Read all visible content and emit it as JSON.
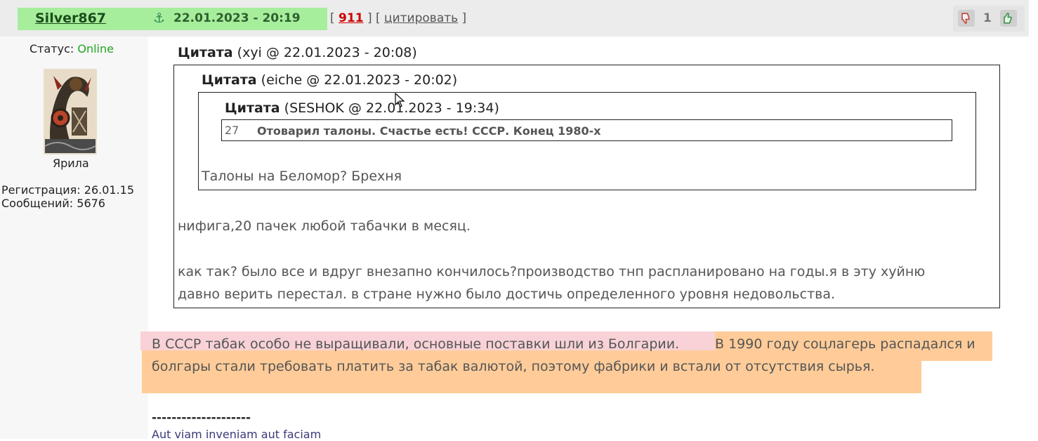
{
  "header": {
    "username": "Silver867",
    "datetime": "22.01.2023 - 20:19",
    "post_number": "911",
    "quote_label": "цитировать",
    "vote_count": "1",
    "icons": {
      "anchor": "anchor-icon",
      "dislike": "thumb-down-icon",
      "like": "thumb-up-icon"
    },
    "colors": {
      "user_bg": "#a6ee9c",
      "post_number": "#cc0000",
      "online": "#22a522"
    }
  },
  "sidebar": {
    "status_label": "Статус:",
    "status_value": "Online",
    "avatar_name": "Ярила",
    "registration": "Регистрация: 26.01.15",
    "messages": "Сообщений: 5676"
  },
  "quotes": {
    "outer": {
      "label": "Цитата",
      "meta": "(xyi @ 22.01.2023 - 20:08)"
    },
    "middle": {
      "label": "Цитата",
      "meta": "(eiche @ 22.01.2023 - 20:02)"
    },
    "inner": {
      "label": "Цитата",
      "meta": "(SESHOK @ 22.01.2023 - 19:34)"
    },
    "inner_link_num": "27",
    "inner_link_title": "Отоварил талоны. Счастье есть! СССР. Конец 1980-х",
    "middle_text": "Талоны на Беломор? Брехня",
    "outer_text_1": "нифига,20 пачек любой табачки в месяц.",
    "outer_text_2": "как так? было все и вдруг внезапно кончилось?производство тнп распланировано на годы.я в эту хуйню",
    "outer_text_3": "давно верить перестал. в стране нужно было достичь определенного уровня недовольства."
  },
  "post": {
    "line1_part1": "В СССР табак особо не выращивали, основные поставки шли из Болгарии.",
    "line1_part2": "В 1990 году соцлагерь распадался и",
    "line2": "болгары стали требовать платить за табак валютой, поэтому фабрики и встали от отсутствия сырья."
  },
  "signature": {
    "separator": "--------------------",
    "text": "Aut viam inveniam aut faciam"
  }
}
